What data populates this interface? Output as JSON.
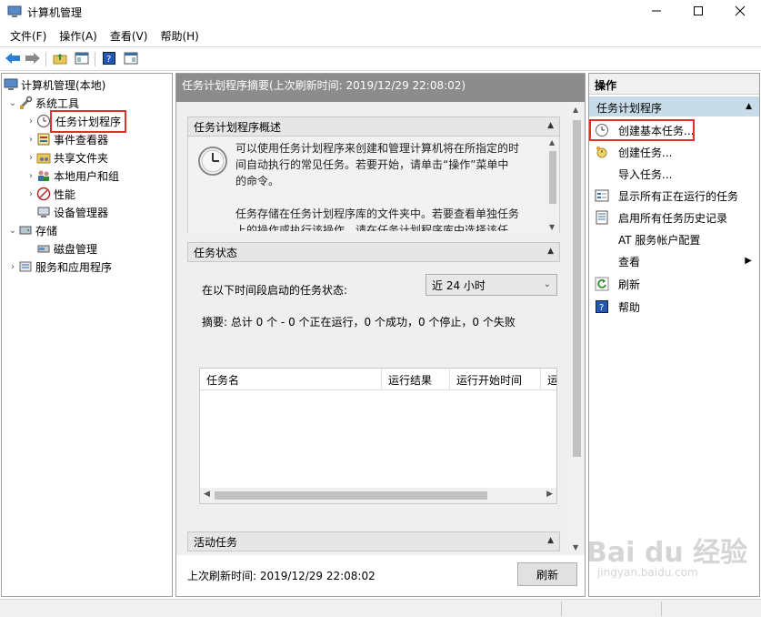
{
  "window": {
    "title": "计算机管理"
  },
  "menubar": {
    "items": [
      "文件(F)",
      "操作(A)",
      "查看(V)",
      "帮助(H)"
    ]
  },
  "tree": {
    "root": "计算机管理(本地)",
    "system_tools": "系统工具",
    "task_scheduler": "任务计划程序",
    "event_viewer": "事件查看器",
    "shared_folders": "共享文件夹",
    "local_users": "本地用户和组",
    "performance": "性能",
    "device_manager": "设备管理器",
    "storage": "存储",
    "disk_management": "磁盘管理",
    "services_apps": "服务和应用程序"
  },
  "center": {
    "header": "任务计划程序摘要(上次刷新时间: 2019/12/29 22:08:02)",
    "overview": {
      "title": "任务计划程序概述",
      "para1_line1": "可以使用任务计划程序来创建和管理计算机将在所指定的时",
      "para1_line2": "间自动执行的常见任务。若要开始，请单击“操作”菜单中",
      "para1_line3": "的命令。",
      "para2_line1": "任务存储在任务计划程序库的文件夹中。若要查看单独任务",
      "para2_line2": "上的操作或执行该操作，请在任务计划程序库中选择该任"
    },
    "status": {
      "title": "任务状态",
      "period_label": "在以下时间段启动的任务状态:",
      "period_value": "近 24 小时",
      "summary": "摘要: 总计 0 个 - 0 个正在运行，0 个成功，0 个停止，0 个失败",
      "columns": [
        "任务名",
        "运行结果",
        "运行开始时间",
        "运"
      ]
    },
    "active": {
      "title": "活动任务"
    },
    "footer": {
      "last_refresh": "上次刷新时间: 2019/12/29 22:08:02",
      "refresh_button": "刷新"
    }
  },
  "actions": {
    "header": "操作",
    "group": "任务计划程序",
    "items": [
      "创建基本任务...",
      "创建任务...",
      "导入任务...",
      "显示所有正在运行的任务",
      "启用所有任务历史记录",
      "AT 服务帐户配置",
      "查看",
      "刷新",
      "帮助"
    ]
  },
  "watermark": {
    "text": "Bai du 经验",
    "url_text": "jingyan.baidu.com"
  },
  "colors": {
    "selection_highlight": "#e03030",
    "center_header_bg": "#8c8c8c",
    "actions_group_bg": "#c7dbe9"
  }
}
